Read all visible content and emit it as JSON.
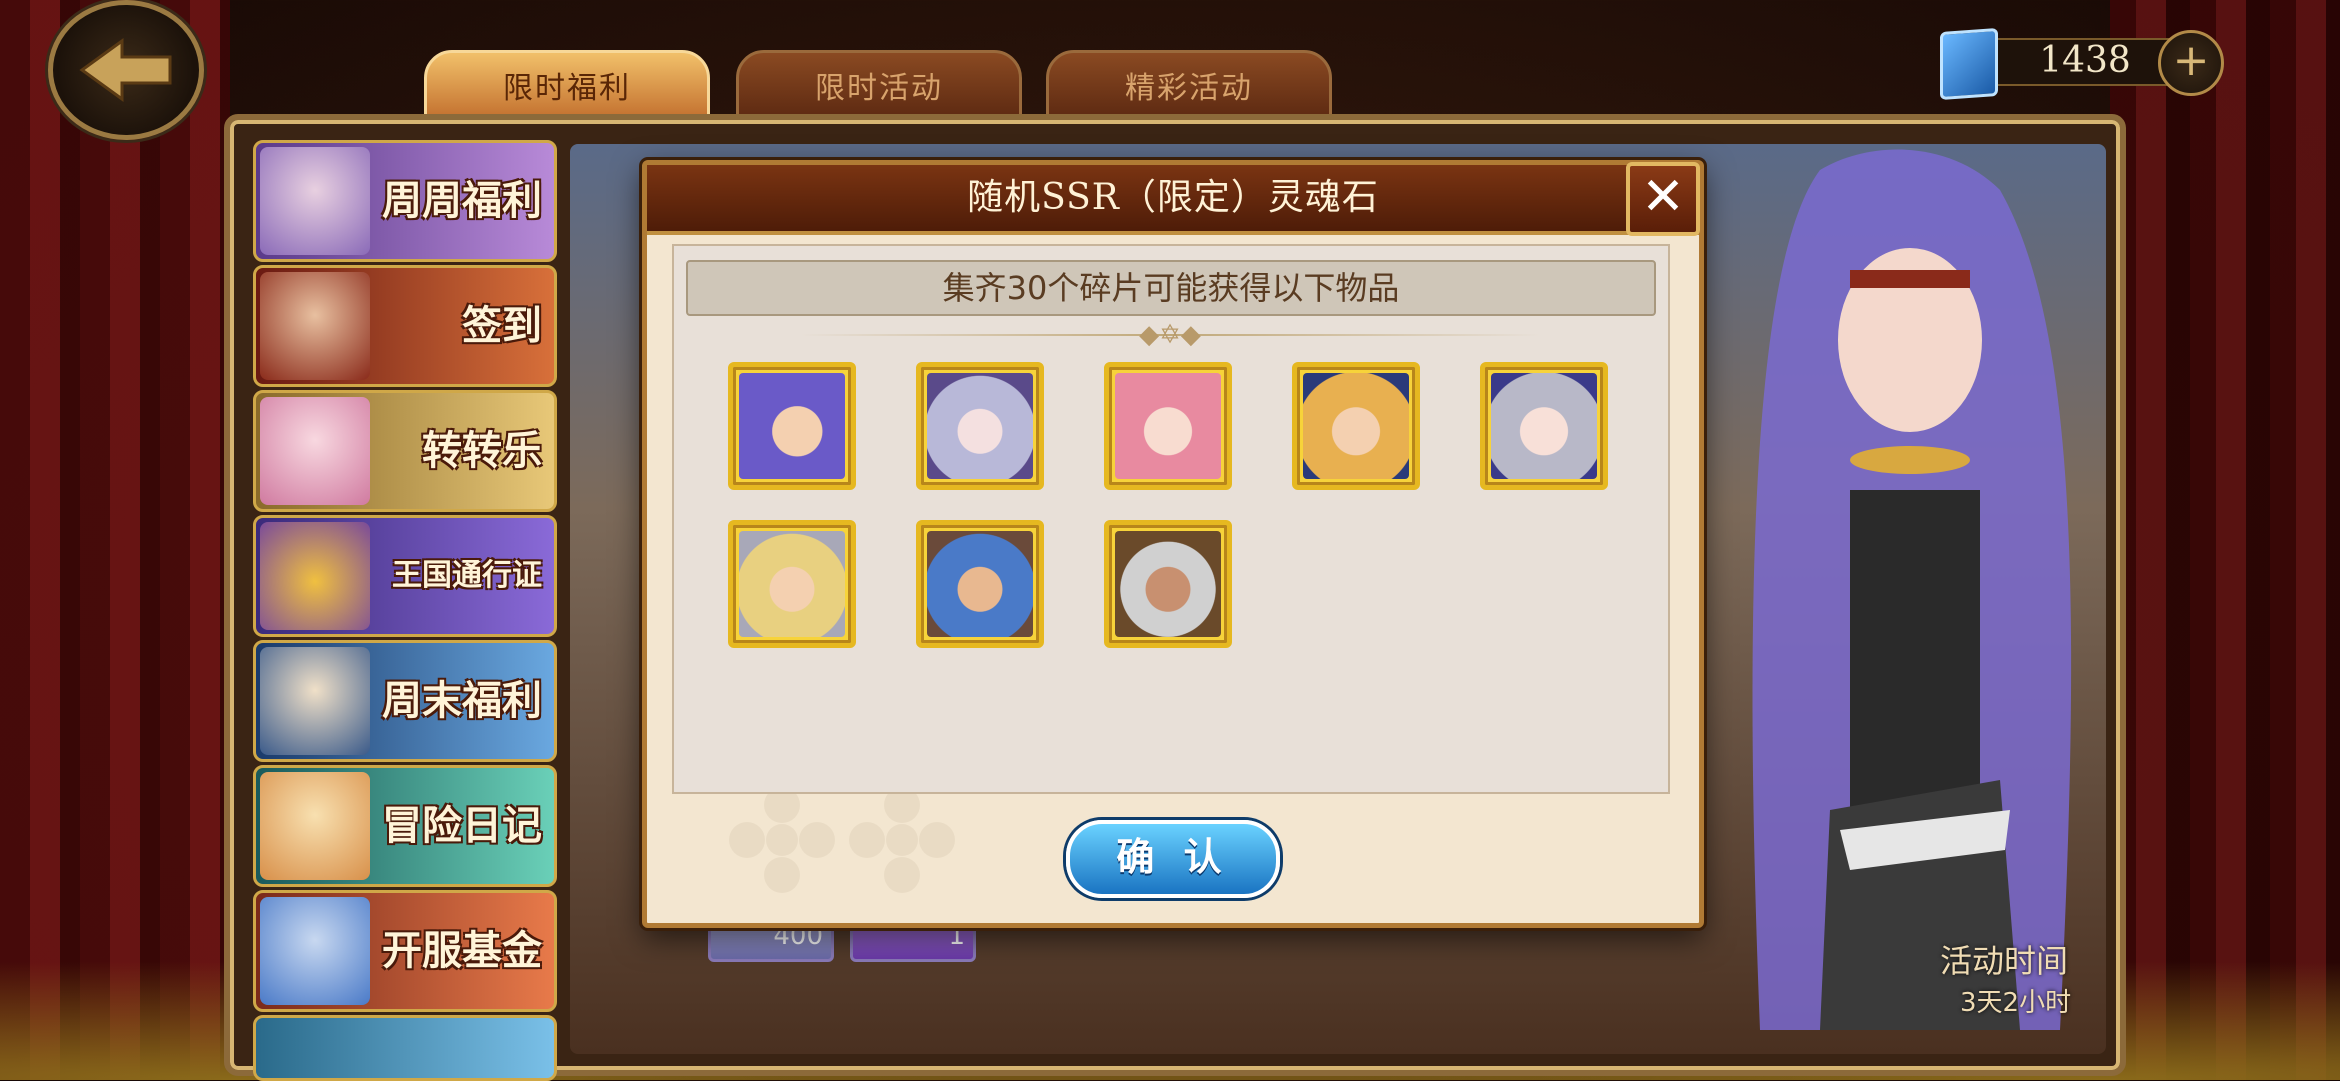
{
  "currency": {
    "amount": "1438",
    "add_label": "+"
  },
  "tabs": [
    {
      "label": "限时福利",
      "active": true
    },
    {
      "label": "限时活动",
      "active": false
    },
    {
      "label": "精彩活动",
      "active": false
    }
  ],
  "sidebar": {
    "items": [
      {
        "label": "周周福利",
        "color": "#9a6ad8"
      },
      {
        "label": "签到",
        "color": "#c04a2a"
      },
      {
        "label": "转转乐",
        "color": "#d8b460"
      },
      {
        "label": "王国通行证",
        "color": "#7a5ac8"
      },
      {
        "label": "周末福利",
        "color": "#4a8ac8"
      },
      {
        "label": "冒险日记",
        "color": "#3aa89a"
      },
      {
        "label": "开服基金",
        "color": "#d05a3a"
      }
    ]
  },
  "activity": {
    "label": "活动时间",
    "time": "3天2小时"
  },
  "background_items": [
    {
      "count": "400"
    },
    {
      "count": "1"
    }
  ],
  "modal": {
    "title": "随机SSR（限定）灵魂石",
    "subtitle": "集齐30个碎片可能获得以下物品",
    "confirm_label": "确 认",
    "close_label": "✕",
    "rewards": [
      {
        "name": "hero-purple-hair",
        "color": "#6a5ac8"
      },
      {
        "name": "hero-white-hood",
        "color": "#b8b8d8"
      },
      {
        "name": "hero-pink-hair",
        "color": "#e88aa0"
      },
      {
        "name": "hero-blonde-long",
        "color": "#e8b050"
      },
      {
        "name": "hero-silver-hair",
        "color": "#b8b8c8"
      },
      {
        "name": "hero-valkyrie",
        "color": "#e8d080"
      },
      {
        "name": "hero-blue-hair",
        "color": "#4a7ac8"
      },
      {
        "name": "hero-old-warrior",
        "color": "#8a6a4a"
      }
    ]
  }
}
